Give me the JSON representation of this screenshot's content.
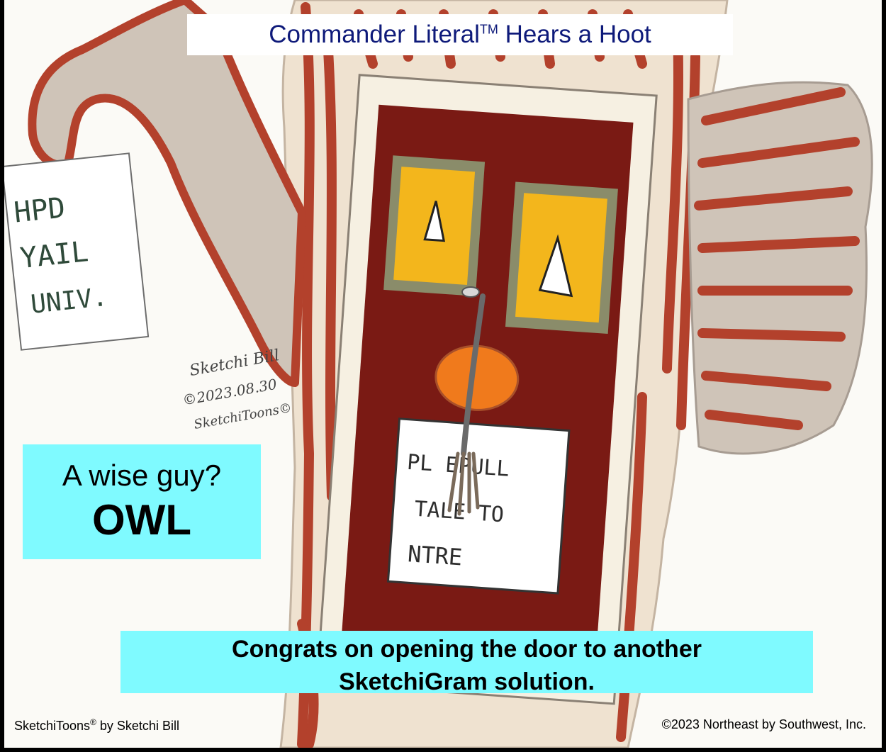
{
  "title": {
    "text": "Commander Literal",
    "trademark": "TM",
    "text_after": " Hears a Hoot"
  },
  "sign_left": {
    "line1": "HPD",
    "line2": "YAIL",
    "line3": "UNIV."
  },
  "door_sign": {
    "line1": "PL    EPULL",
    "line2": "TALE TO",
    "line3": "NTRE"
  },
  "signature": {
    "line1": "Sketchi Bill",
    "line2": "©2023.08.30",
    "line3": "SketchiToons©"
  },
  "riddle": {
    "question": "A wise guy?",
    "answer": "OWL"
  },
  "congrats": {
    "line1": "Congrats on opening the door to another",
    "line2": "SketchiGram solution."
  },
  "footer": {
    "left_brand": "SketchiToons",
    "left_reg": "®",
    "left_rest": " by Sketchi Bill",
    "right": "©2023 Northeast by Southwest, Inc."
  },
  "colors": {
    "background": "#000000",
    "paper": "#fbfaf6",
    "title_text": "#0e1a7a",
    "caption_box": "#7ffaff",
    "owl_red": "#b3412c",
    "door": "#7a1a14",
    "eye_yellow": "#f3b61c",
    "beak_orange": "#f07a1c",
    "feather_gray": "#a79c92"
  }
}
